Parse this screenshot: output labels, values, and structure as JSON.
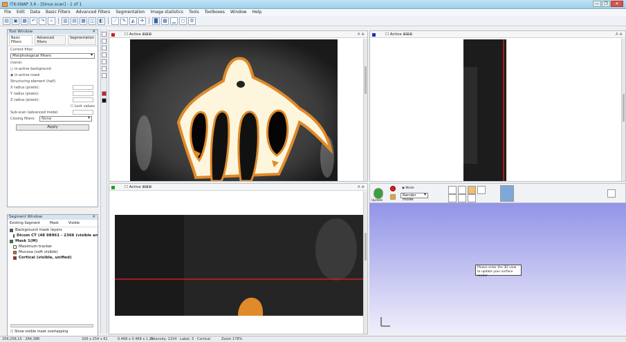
{
  "window": {
    "title": "ITK-SNAP 3.6 - [Sinus scan] - 1 of 1",
    "controls": [
      "—",
      "❐",
      "✕"
    ]
  },
  "menu": [
    "File",
    "Edit",
    "Data",
    "Basic Filters",
    "Advanced Filters",
    "Segmentation",
    "Image statistics",
    "Tools",
    "Toolboxes",
    "Window",
    "Help"
  ],
  "toolbar_icons": [
    "open-icon",
    "save-icon",
    "save-as-icon",
    "undo-icon",
    "redo-icon",
    "zoom-icon",
    "layout-1-icon",
    "layout-2-icon",
    "layout-3-icon",
    "snapshot-icon",
    "segmentation-icon",
    "measure-icon",
    "pencil-icon",
    "bucket-icon",
    "crosshair-icon",
    "histogram-icon",
    "grid-icon",
    "chart-icon",
    "window-icon",
    "settings-icon"
  ],
  "tool_panel": {
    "title": "Tool Window",
    "tabs": [
      "Basic Filters",
      "Advanced filters",
      "Segmentation"
    ],
    "filter_label": "Current filter:",
    "filter_value": "Morphological filters",
    "options": [
      "(none)",
      "in-active background",
      "in-active mask"
    ],
    "structuring_label": "Structuring element (half)",
    "radius_rows": [
      "X radius (pixels):",
      "Y radius (pixels):",
      "Z radius (pixels):"
    ],
    "lock_label": "Lock values",
    "sub_label": "Sub-scan (advanced mode)",
    "closing_label": "Closing filters:",
    "closing_value": "None",
    "apply": "Apply"
  },
  "segment_panel": {
    "title": "Segment Window",
    "cols": [
      "Existing Segment",
      "Mask",
      "Visible"
    ],
    "rows": [
      {
        "text": "Background mask layers",
        "level": 0,
        "color": "#3a5fa8",
        "bold": false
      },
      {
        "text": "Dicom CT (48 98961 - 2366 (visible ant)",
        "level": 1,
        "color": "#1e2e5a",
        "bold": true
      },
      {
        "text": "Mask 1(M)",
        "level": 0,
        "color": "#2a8f3a",
        "bold": true
      },
      {
        "text": "Maximum tracker",
        "level": 1,
        "color": "#ffffff",
        "bold": false
      },
      {
        "text": "Mucosa (soft visible)",
        "level": 1,
        "color": "#d97a1a",
        "bold": false
      },
      {
        "text": "Cortical (visible, unified)",
        "level": 1,
        "color": "#c02020",
        "bold": true
      }
    ],
    "checkbox": "Show visible mask overlapping"
  },
  "viewports": {
    "axial": {
      "label": "Active",
      "marker": "#d02020",
      "r": "A  ⊕"
    },
    "sagittal": {
      "label": "Active",
      "marker": "#2030c0",
      "r": "A  ⊕"
    },
    "coronal": {
      "label": "Active",
      "marker": "#20a020",
      "r": "A  ⊕"
    },
    "threed": {
      "update": "Update",
      "mode": "Render mode",
      "msg": "Please enter the 3D view to update your surface render"
    }
  },
  "status": {
    "coords": "256,256,15  ·  284,388",
    "size": "326 x 254 x 61",
    "mm": "0.468 x 0.468 x 1.25",
    "intensity": "Intensity: 1154  ·  Label: 3  ·  Cortical",
    "zoom": "Zoom 178%"
  },
  "colors": {
    "accent": "#2e6bb3",
    "bone": "#fdf6dc",
    "bone_edge": "#e08a2a",
    "crosshair": "#d02020",
    "background_3d": "#a6a8ee"
  }
}
